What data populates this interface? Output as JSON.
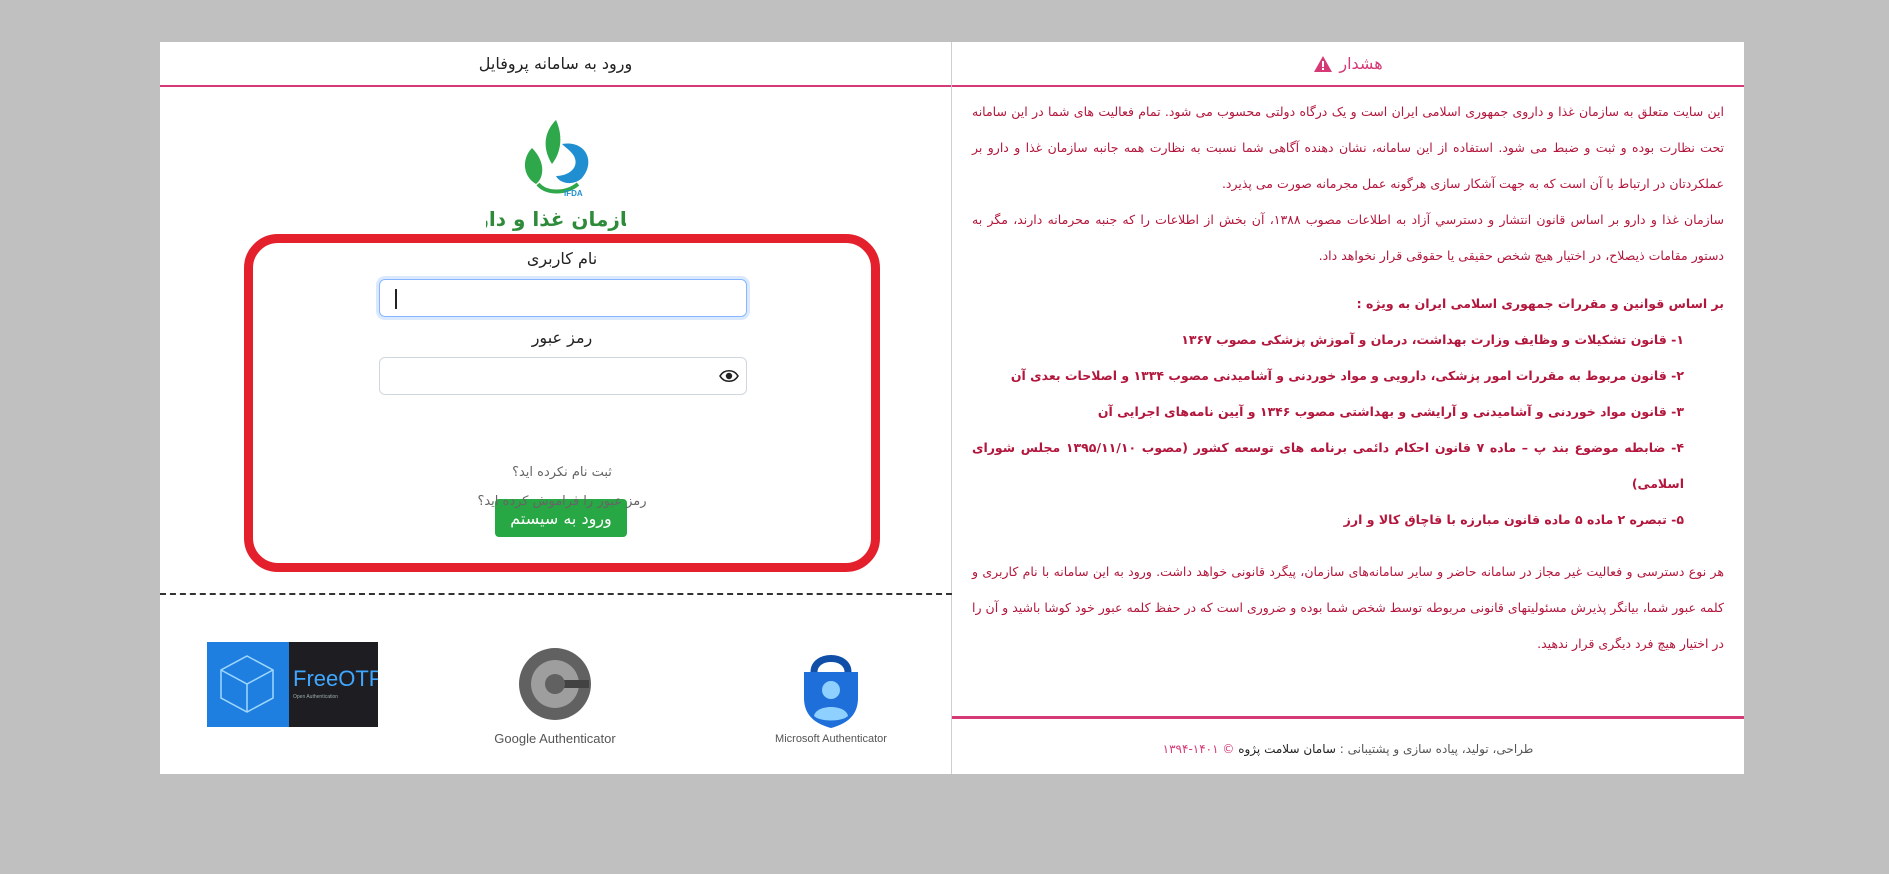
{
  "login": {
    "header_title": "ورود به سامانه پروفایل",
    "logo": {
      "abbr": "IFDA",
      "text": "سازمان غذا و دارو"
    },
    "username_label": "نام کاربری",
    "username_value": "",
    "password_label": "رمز عبور",
    "password_value": "",
    "submit_label": "ورود به سیستم",
    "register_link": "ثبت نام نکرده اید؟",
    "forgot_link": "رمز عبور را فراموش کرده اید؟"
  },
  "authenticators": {
    "freeotp": {
      "name": "FreeOTP",
      "sub": "Open Authentication"
    },
    "google": {
      "name": "Google Authenticator"
    },
    "microsoft": {
      "name": "Microsoft Authenticator"
    }
  },
  "warning": {
    "title": "هشدار",
    "para1": "این سایت متعلق به سازمان غذا و داروی جمهوری اسلامی ایران است و یک درگاه دولتی محسوب می شود. تمام فعالیت های شما در این سامانه تحت نظارت بوده و ثبت و ضبط می شود. استفاده از این سامانه، نشان دهنده آگاهی شما نسبت به نظارت همه جانبه سازمان غذا و دارو بر عملکردتان در ارتباط با آن است که به جهت آشکار سازی هرگونه عمل مجرمانه صورت می پذیرد.",
    "para2": "سازمان غذا و دارو بر اساس قانون انتشار و دسترسي آزاد به اطلاعات مصوب ۱۳۸۸، آن بخش از اطلاعات را که جنبه محرمانه دارند، مگر به دستور مقامات ذیصلاح، در اختیار هیچ شخص حقیقی یا حقوقی قرار نخواهد داد.",
    "laws_heading": "بر اساس قوانین و مقررات جمهوری اسلامی ایران به ویژه :",
    "laws": [
      "۱- قانون تشکیلات و وظایف وزارت بهداشت، درمان و آموزش پزشکی مصوب ۱۳۶۷",
      "۲- قانون مربوط به مقررات امور پزشکی، دارویی و مواد خوردنی و آشامیدنی مصوب ۱۳۳۴ و اصلاحات بعدی آن",
      "۳- قانون مواد خوردنی و آشامیدنی و آرایشی و بهداشتی مصوب ۱۳۴۶ و آیین نامه‌های اجرایی آن",
      "۴- ضابطه موضوع بند پ – ماده ۷ قانون احکام دائمی برنامه های توسعه کشور (مصوب ۱۳۹۵/۱۱/۱۰ مجلس شورای اسلامی)",
      "۵- تبصره ۲ ماده ۵ ماده قانون مبارزه با قاچاق کالا و ارز"
    ],
    "para3": "هر نوع دسترسی و فعالیت غیر مجاز در سامانه حاضر و سایر سامانه‌های سازمان، پیگرد قانونی خواهد داشت. ورود به این سامانه با نام کاربری و کلمه عبور شما، بیانگر پذیرش مسئولیتهای قانونی مربوطه توسط شخص شما بوده و ضروری است که در حفظ کلمه عبور خود کوشا باشید و آن را در اختیار هیچ فرد دیگری قرار ندهید."
  },
  "footer": {
    "prefix": "طراحی، تولید، پیاده سازی و پشتیبانی :",
    "company": "سامان سلامت پژوه",
    "copyright": "© ۱۴۰۱-۱۳۹۴"
  },
  "colors": {
    "accent": "#d63a76",
    "warning_text": "#b3163c",
    "login_box_border": "#e3202b",
    "submit_button": "#28a745",
    "background": "#c0c0c0"
  }
}
